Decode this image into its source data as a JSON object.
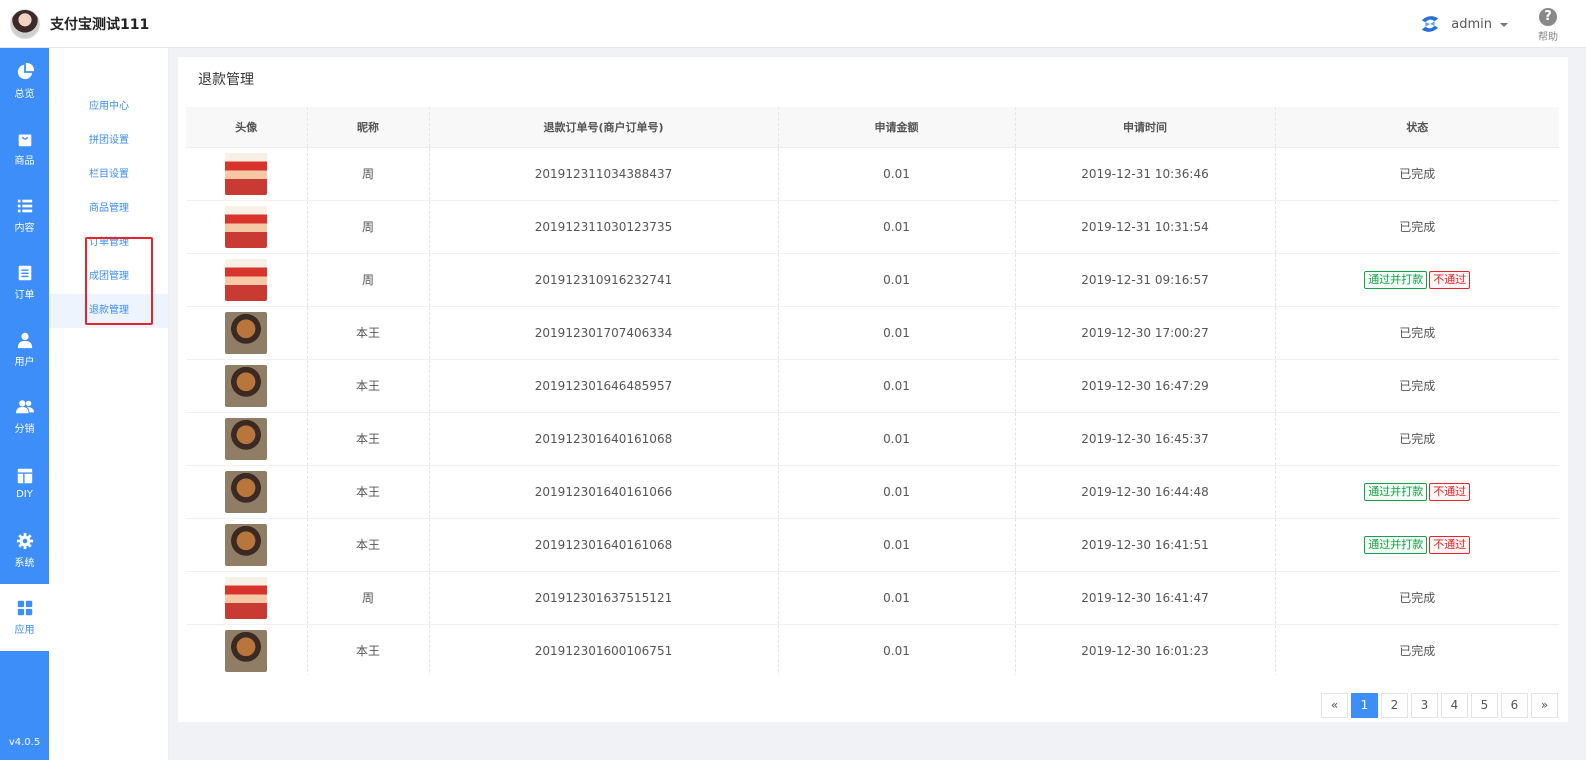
{
  "brand": {
    "name": "支付宝测试111"
  },
  "user": {
    "name": "admin"
  },
  "help": {
    "label": "帮助"
  },
  "nav": {
    "items": [
      {
        "label": "总览",
        "icon": "pie-chart-icon"
      },
      {
        "label": "商品",
        "icon": "bag-icon"
      },
      {
        "label": "内容",
        "icon": "list-icon"
      },
      {
        "label": "订单",
        "icon": "document-icon"
      },
      {
        "label": "用户",
        "icon": "user-icon"
      },
      {
        "label": "分销",
        "icon": "users-icon"
      },
      {
        "label": "DIY",
        "icon": "layout-icon"
      },
      {
        "label": "系统",
        "icon": "gear-icon"
      },
      {
        "label": "应用",
        "icon": "grid-icon"
      }
    ],
    "version": "v4.0.5"
  },
  "submenu": {
    "items": [
      {
        "label": "应用中心"
      },
      {
        "label": "拼团设置"
      },
      {
        "label": "栏目设置"
      },
      {
        "label": "商品管理"
      },
      {
        "label": "订单管理"
      },
      {
        "label": "成团管理"
      },
      {
        "label": "退款管理"
      }
    ]
  },
  "page": {
    "title": "退款管理"
  },
  "table": {
    "headers": [
      "头像",
      "昵称",
      "退款订单号(商户订单号)",
      "申请金额",
      "申请时间",
      "状态"
    ],
    "status_done": "已完成",
    "action_pass": "通过并打款",
    "action_reject": "不通过",
    "rows": [
      {
        "avatar": "boy",
        "nickname": "周",
        "order_no": "201912311034388437",
        "amount": "0.01",
        "time": "2019-12-31 10:36:46",
        "status": "done"
      },
      {
        "avatar": "boy",
        "nickname": "周",
        "order_no": "201912311030123735",
        "amount": "0.01",
        "time": "2019-12-31 10:31:54",
        "status": "done"
      },
      {
        "avatar": "boy",
        "nickname": "周",
        "order_no": "201912310916232741",
        "amount": "0.01",
        "time": "2019-12-31 09:16:57",
        "status": "pending"
      },
      {
        "avatar": "dog",
        "nickname": "本王",
        "order_no": "201912301707406334",
        "amount": "0.01",
        "time": "2019-12-30 17:00:27",
        "status": "done"
      },
      {
        "avatar": "dog",
        "nickname": "本王",
        "order_no": "201912301646485957",
        "amount": "0.01",
        "time": "2019-12-30 16:47:29",
        "status": "done"
      },
      {
        "avatar": "dog",
        "nickname": "本王",
        "order_no": "201912301640161068",
        "amount": "0.01",
        "time": "2019-12-30 16:45:37",
        "status": "done"
      },
      {
        "avatar": "dog",
        "nickname": "本王",
        "order_no": "201912301640161066",
        "amount": "0.01",
        "time": "2019-12-30 16:44:48",
        "status": "pending"
      },
      {
        "avatar": "dog",
        "nickname": "本王",
        "order_no": "201912301640161068",
        "amount": "0.01",
        "time": "2019-12-30 16:41:51",
        "status": "pending"
      },
      {
        "avatar": "boy",
        "nickname": "周",
        "order_no": "201912301637515121",
        "amount": "0.01",
        "time": "2019-12-30 16:41:47",
        "status": "done"
      },
      {
        "avatar": "dog",
        "nickname": "本王",
        "order_no": "201912301600106751",
        "amount": "0.01",
        "time": "2019-12-30 16:01:23",
        "status": "done"
      }
    ]
  },
  "pagination": {
    "prev": "«",
    "next": "»",
    "pages": [
      "1",
      "2",
      "3",
      "4",
      "5",
      "6"
    ],
    "current": "1"
  },
  "colors": {
    "accent": "#3d8ef8",
    "pass": "#19a04a",
    "reject": "#e4262a"
  }
}
